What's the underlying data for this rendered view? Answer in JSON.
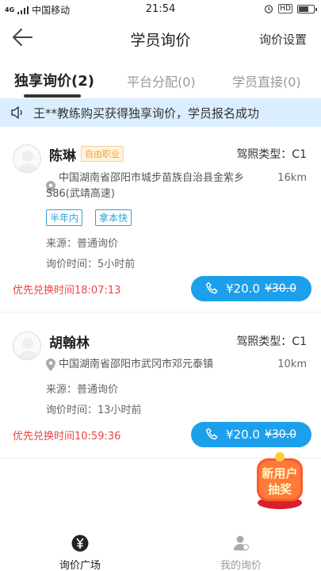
{
  "status_bar": {
    "signal": "4G",
    "carrier": "中国移动",
    "time": "21:54",
    "hd": "HD"
  },
  "nav": {
    "title": "学员询价",
    "right_action": "询价设置"
  },
  "tabs": [
    {
      "label": "独享询价(2)",
      "active": true
    },
    {
      "label": "平台分配(0)",
      "active": false
    },
    {
      "label": "学员直接(0)",
      "active": false
    }
  ],
  "notice": {
    "text": "王**教练购买获得独享询价，学员报名成功"
  },
  "inquiries": [
    {
      "name": "陈琳",
      "tag": "自由职业",
      "license": "驾照类型：C1",
      "address_line1": "中国湖南省邵阳市城步苗族自治县金紫乡",
      "address_line2": "S86(武靖高速)",
      "distance": "16km",
      "tags": [
        "半年内",
        "拿本快"
      ],
      "source": "来源：普通询价",
      "inquiry_time": "询价时间：5小时前",
      "deadline": "优先兑换时间18:07:13",
      "price_now": "¥20.0",
      "price_old": "¥30.0"
    },
    {
      "name": "胡翰林",
      "license": "驾照类型：C1",
      "address_line1": "中国湖南省邵阳市武冈市邓元泰镇",
      "distance": "10km",
      "source": "来源：普通询价",
      "inquiry_time": "询价时间：13小时前",
      "deadline": "优先兑换时间10:59:36",
      "price_now": "¥20.0",
      "price_old": "¥30.0"
    }
  ],
  "promo": {
    "line1": "新用户",
    "line2": "抽奖"
  },
  "bottom_nav": [
    {
      "label": "询价广场",
      "active": true,
      "icon": "yuan-coin-icon"
    },
    {
      "label": "我的询价",
      "active": false,
      "icon": "person-icon"
    }
  ],
  "colors": {
    "accent": "#1da0ec",
    "deadline": "#ee4444",
    "notice_bg": "#dbeeff"
  }
}
